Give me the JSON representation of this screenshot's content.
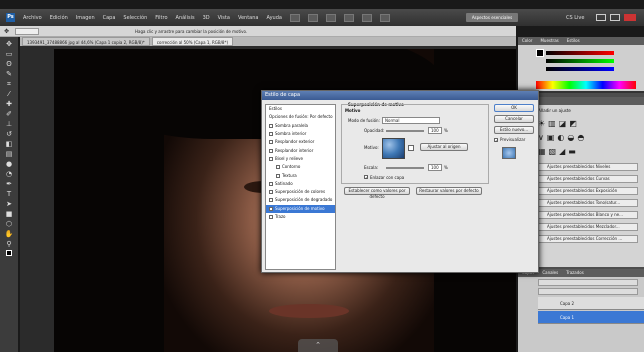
{
  "app": {
    "logo": "Ps",
    "essentials": "Aspectos esenciales",
    "menus": [
      "Archivo",
      "Edición",
      "Imagen",
      "Capa",
      "Selección",
      "Filtro",
      "Análisis",
      "3D",
      "Vista",
      "Ventana",
      "Ayuda"
    ],
    "cslive": "CS Live"
  },
  "options_bar": {
    "hint": "Haga clic y arrastre para cambiar la posición de motivo."
  },
  "tabs": [
    {
      "label": "1393491_37488866 jpg al 44,6% (Capa 1 copia 2, RGB/8)*"
    },
    {
      "label": "corrección al 50% (Capa 1, RGB/8*)"
    }
  ],
  "dialog": {
    "title": "Estilo de capa",
    "styles": [
      {
        "label": "Estilos",
        "checkbox": false,
        "selected": false
      },
      {
        "label": "Opciones de fusión: Por defecto",
        "checkbox": false,
        "selected": false
      },
      {
        "label": "Sombra paralela",
        "checkbox": true,
        "selected": false
      },
      {
        "label": "Sombra interior",
        "checkbox": true,
        "selected": false
      },
      {
        "label": "Resplandor exterior",
        "checkbox": true,
        "selected": false
      },
      {
        "label": "Resplandor interior",
        "checkbox": true,
        "selected": false
      },
      {
        "label": "Bisel y relieve",
        "checkbox": true,
        "selected": false
      },
      {
        "label": "Contorno",
        "checkbox": true,
        "selected": false
      },
      {
        "label": "Textura",
        "checkbox": true,
        "selected": false
      },
      {
        "label": "Satinado",
        "checkbox": true,
        "selected": false
      },
      {
        "label": "Superposición de colores",
        "checkbox": true,
        "selected": false
      },
      {
        "label": "Superposición de degradado",
        "checkbox": true,
        "selected": false
      },
      {
        "label": "Superposición de motivo",
        "checkbox": true,
        "selected": true
      },
      {
        "label": "Trazo",
        "checkbox": true,
        "selected": false
      }
    ],
    "section": "Superposición de motivo",
    "group": "Motivo",
    "blend_label": "Modo de fusión:",
    "blend_value": "Normal",
    "opacity_label": "Opacidad:",
    "opacity_value": "100",
    "opacity_unit": "%",
    "pattern_label": "Motivo:",
    "snap_button": "Ajustar al origen",
    "scale_label": "Escala:",
    "scale_value": "100",
    "scale_unit": "%",
    "link_label": "Enlazar con capa",
    "default_button": "Establecer como valores por defecto",
    "reset_button": "Restaurar valores por defecto",
    "ok": "OK",
    "cancel": "Cancelar",
    "new_style": "Estilo nuevo...",
    "preview": "Previsualizar"
  },
  "adjustments": {
    "tab": "Ajustes",
    "header": "Añadir un ajuste",
    "presets": [
      "Ajustes preestablecidos Niveles",
      "Ajustes preestablecidos Curvas",
      "Ajustes preestablecidos Exposición",
      "Ajustes preestablecidos Tono/satur...",
      "Ajustes preestablecidos Blanco y ne...",
      "Ajustes preestablecidos Mezclador...",
      "Ajustes preestablecidos Corrección ..."
    ]
  },
  "color_panel": {
    "tabs": [
      "Color",
      "Muestras",
      "Estilos"
    ]
  },
  "layers": {
    "tabs": [
      "Capas",
      "Canales",
      "Trazados"
    ],
    "rows": [
      {
        "label": "Capa 2"
      },
      {
        "label": "Capa 1"
      }
    ]
  }
}
